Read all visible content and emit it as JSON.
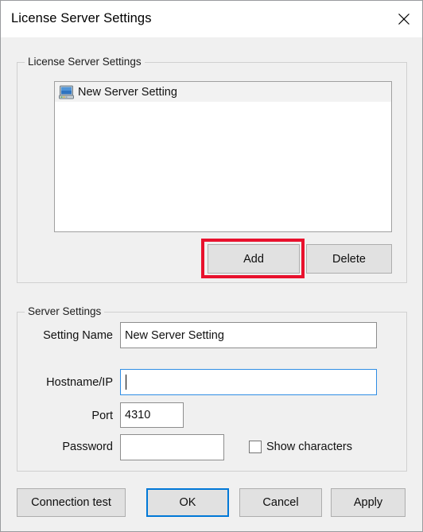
{
  "window": {
    "title": "License Server Settings",
    "close_icon": "close-icon"
  },
  "license_server_group": {
    "legend": "License Server Settings",
    "list": {
      "items": [
        {
          "icon": "computer-monitor-icon",
          "label": "New Server Setting",
          "selected": true
        }
      ]
    },
    "buttons": {
      "add": "Add",
      "delete": "Delete"
    },
    "annotation": {
      "target": "add-button",
      "color": "#e8112d"
    }
  },
  "server_settings_group": {
    "legend": "Server Settings",
    "fields": {
      "setting_name": {
        "label": "Setting Name",
        "value": "New Server Setting",
        "placeholder": "",
        "focused": false
      },
      "hostname_ip": {
        "label": "Hostname/IP",
        "value": "",
        "placeholder": "",
        "focused": true
      },
      "port": {
        "label": "Port",
        "value": "4310",
        "placeholder": "",
        "focused": false
      },
      "password": {
        "label": "Password",
        "value": "",
        "placeholder": "",
        "focused": false
      }
    },
    "show_characters": {
      "label": "Show characters",
      "checked": false
    }
  },
  "footer": {
    "connection_test": "Connection test",
    "ok": "OK",
    "cancel": "Cancel",
    "apply": "Apply",
    "default_button": "OK"
  },
  "colors": {
    "dialog_background": "#f0f0f0",
    "titlebar_background": "#ffffff",
    "accent": "#0078d7",
    "annotation_red": "#e8112d",
    "button_face": "#e1e1e1",
    "selection_row": "#f2f2f2"
  }
}
